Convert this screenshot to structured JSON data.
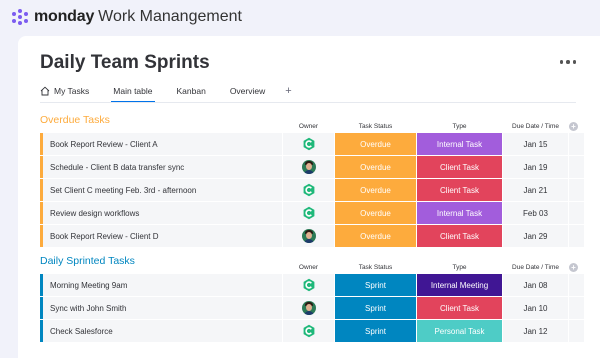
{
  "app": {
    "brand": "monday",
    "subtitle": "Work Manangement"
  },
  "page": {
    "title": "Daily Team Sprints"
  },
  "tabs": [
    "My Tasks",
    "Main table",
    "Kanban",
    "Overview"
  ],
  "tab_add": "+",
  "columns": {
    "owner": "Owner",
    "status": "Task Status",
    "type": "Type",
    "due": "Due Date / Time"
  },
  "add_column": "+",
  "colors": {
    "overdue": "#fdab3d",
    "sprint": "#0086c0",
    "internal_task": "#a25ddc",
    "client_task": "#e2445c",
    "internal_meeting": "#401694",
    "personal_task": "#4eccc6",
    "group_overdue": "#fdab3d",
    "group_sprinted": "#0086c0",
    "accent": "#0073ea"
  },
  "groups": [
    {
      "title": "Overdue Tasks",
      "color": "#fdab3d",
      "rows": [
        {
          "name": "Book Report Review - Client A",
          "owner": "logo",
          "status": "Overdue",
          "status_color": "#fdab3d",
          "type": "Internal Task",
          "type_color": "#a25ddc",
          "due": "Jan 15"
        },
        {
          "name": "Schedule - Client B data transfer sync",
          "owner": "avatar",
          "status": "Overdue",
          "status_color": "#fdab3d",
          "type": "Client Task",
          "type_color": "#e2445c",
          "due": "Jan 19"
        },
        {
          "name": "Set Client C meeting Feb. 3rd - afternoon",
          "owner": "logo",
          "status": "Overdue",
          "status_color": "#fdab3d",
          "type": "Client Task",
          "type_color": "#e2445c",
          "due": "Jan 21"
        },
        {
          "name": "Review design workflows",
          "owner": "logo",
          "status": "Overdue",
          "status_color": "#fdab3d",
          "type": "Internal Task",
          "type_color": "#a25ddc",
          "due": "Feb 03"
        },
        {
          "name": "Book Report Review - Client D",
          "owner": "avatar",
          "status": "Overdue",
          "status_color": "#fdab3d",
          "type": "Client Task",
          "type_color": "#e2445c",
          "due": "Jan 29"
        }
      ]
    },
    {
      "title": "Daily Sprinted Tasks",
      "color": "#0086c0",
      "rows": [
        {
          "name": "Morning Meeting 9am",
          "owner": "logo",
          "status": "Sprint",
          "status_color": "#0086c0",
          "type": "Internal Meeting",
          "type_color": "#401694",
          "due": "Jan 08"
        },
        {
          "name": "Sync with John Smith",
          "owner": "avatar",
          "status": "Sprint",
          "status_color": "#0086c0",
          "type": "Client Task",
          "type_color": "#e2445c",
          "due": "Jan 10"
        },
        {
          "name": "Check Salesforce",
          "owner": "logo",
          "status": "Sprint",
          "status_color": "#0086c0",
          "type": "Personal Task",
          "type_color": "#4eccc6",
          "due": "Jan 12"
        }
      ]
    }
  ]
}
